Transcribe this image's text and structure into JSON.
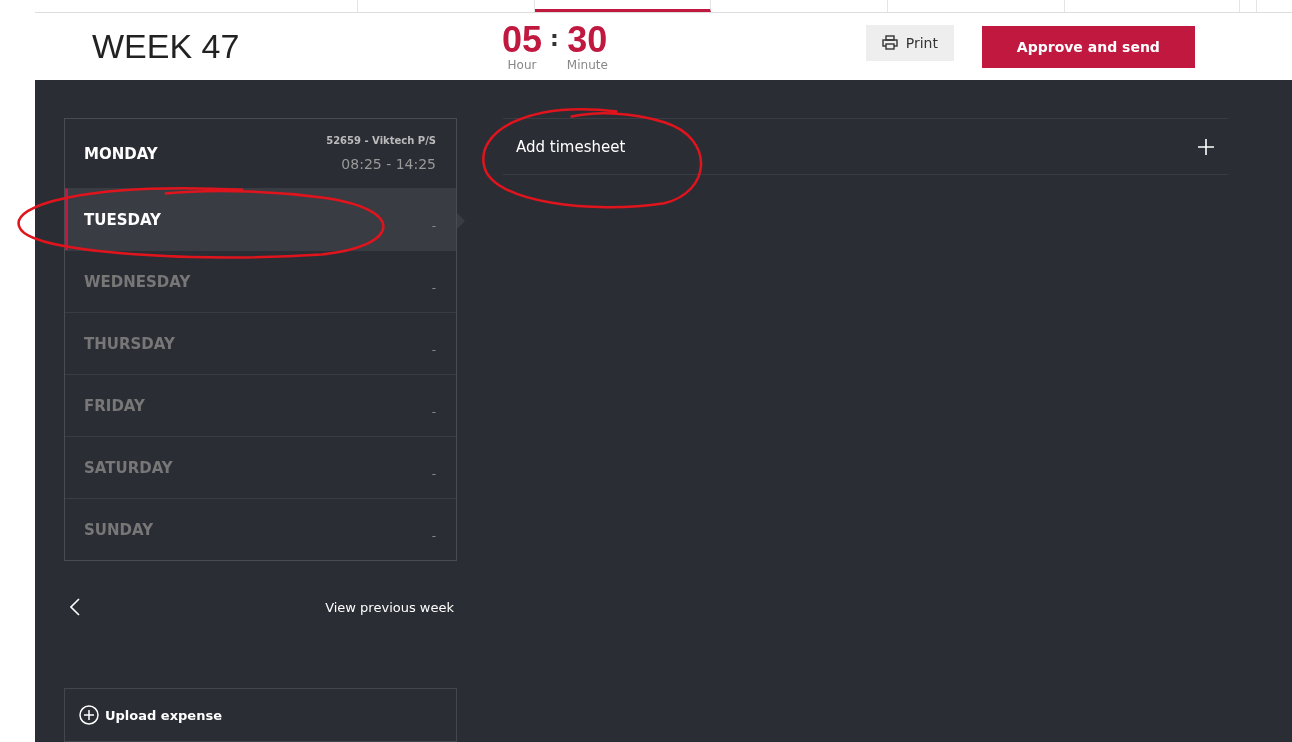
{
  "top_tabs": [
    {
      "selected": false
    },
    {
      "selected": false
    },
    {
      "selected": true
    },
    {
      "selected": false
    },
    {
      "selected": false
    },
    {
      "selected": false
    },
    {
      "selected": false
    }
  ],
  "header": {
    "title": "WEEK 47",
    "hours": "05",
    "separator": ":",
    "minutes": "30",
    "hours_label": "Hour",
    "minutes_label": "Minute",
    "print_button": "Print",
    "approve_button": "Approve and send"
  },
  "days": [
    {
      "name": "MONDAY",
      "selected": false,
      "empty": false,
      "circled": false,
      "project": "52659 - Viktech P/S",
      "time": "08:25 - 14:25"
    },
    {
      "name": "TUESDAY",
      "selected": true,
      "empty": true,
      "circled": true,
      "time": "-"
    },
    {
      "name": "WEDNESDAY",
      "selected": false,
      "empty": true,
      "circled": false,
      "time": "-"
    },
    {
      "name": "THURSDAY",
      "selected": false,
      "empty": true,
      "circled": false,
      "time": "-"
    },
    {
      "name": "FRIDAY",
      "selected": false,
      "empty": true,
      "circled": false,
      "time": "-"
    },
    {
      "name": "SATURDAY",
      "selected": false,
      "empty": true,
      "circled": false,
      "time": "-"
    },
    {
      "name": "SUNDAY",
      "selected": false,
      "empty": true,
      "circled": false,
      "time": "-"
    }
  ],
  "previous_week": "View previous week",
  "upload_expense": "Upload expense",
  "add_timesheet": {
    "label": "Add timesheet",
    "circled": true
  }
}
